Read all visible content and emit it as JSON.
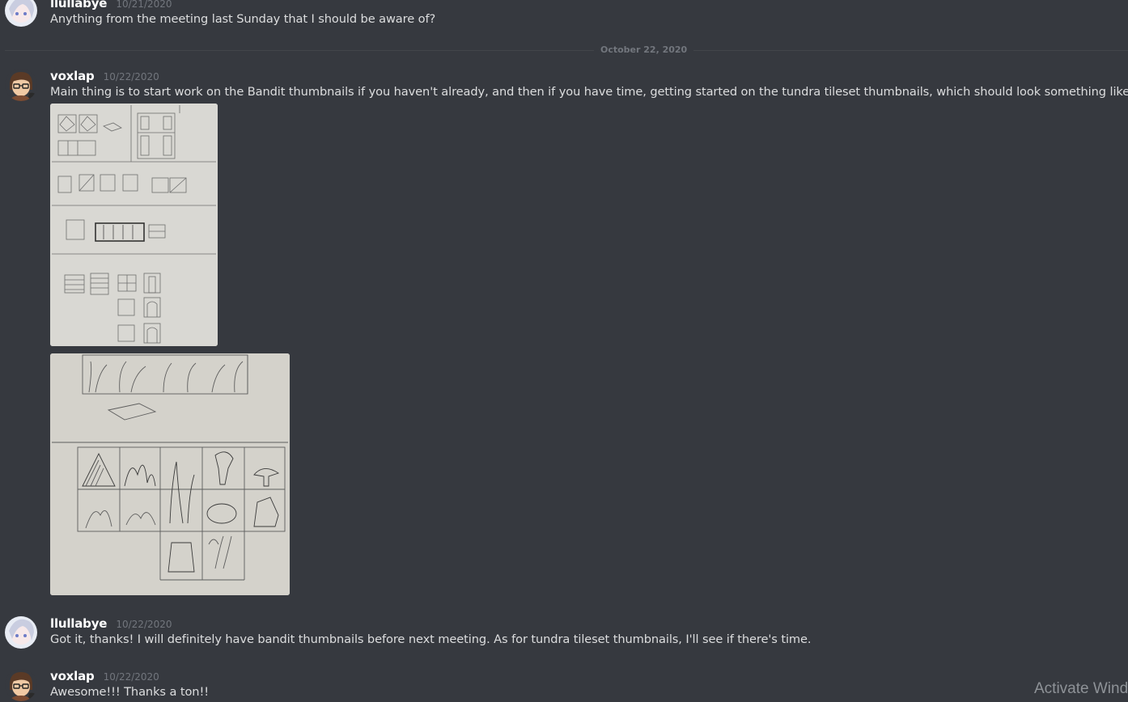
{
  "messages": [
    {
      "username": "llullabye",
      "timestamp": "10/21/2020",
      "text": "Anything from the meeting last Sunday that I should be aware of?"
    },
    {
      "username": "voxlap",
      "timestamp": "10/22/2020",
      "text": "Main thing is to start work on the Bandit thumbnails if you haven't already, and then if you have time, getting started on the tundra tileset thumbnails, which should look something like this:",
      "attachments": [
        "sketch-image",
        "sketch-image"
      ]
    },
    {
      "username": "llullabye",
      "timestamp": "10/22/2020",
      "text": "Got it, thanks! I will definitely have bandit thumbnails before next meeting. As for tundra tileset thumbnails, I'll see if there's time."
    },
    {
      "username": "voxlap",
      "timestamp": "10/22/2020",
      "text": "Awesome!!! Thanks a ton!!"
    }
  ],
  "date_divider": "October 22, 2020",
  "watermark": "Activate Wind",
  "colors": {
    "background": "#36393f",
    "username": "#ffffff",
    "message_text": "#dcddde",
    "timestamp": "#72767d",
    "divider": "#42454a"
  }
}
